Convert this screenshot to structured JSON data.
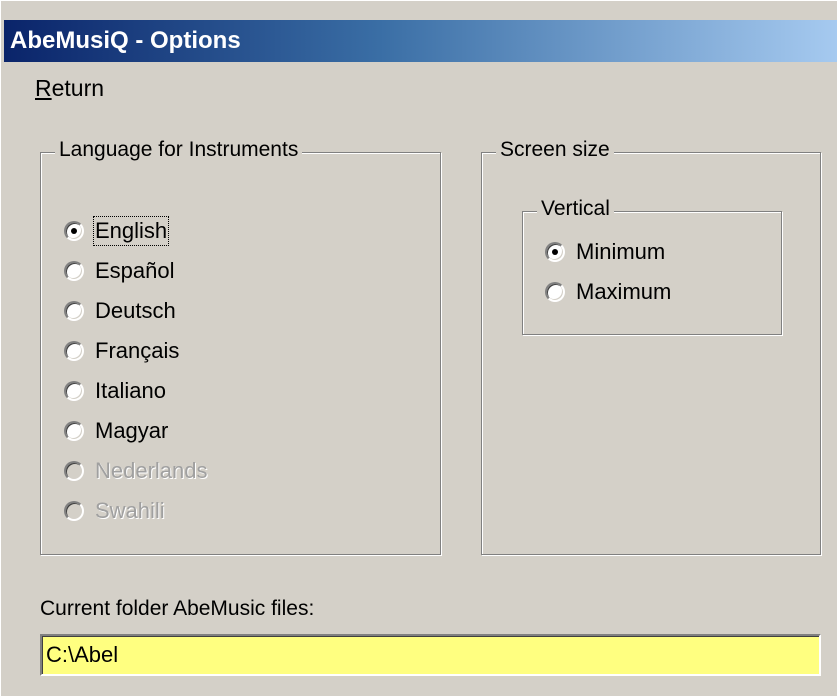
{
  "window": {
    "title": "AbeMusiQ - Options"
  },
  "menu": {
    "return_accel": "R",
    "return_rest": "eturn"
  },
  "language_group": {
    "label": "Language for Instruments",
    "options": [
      {
        "label": "English",
        "checked": true,
        "enabled": true
      },
      {
        "label": "Español",
        "checked": false,
        "enabled": true
      },
      {
        "label": "Deutsch",
        "checked": false,
        "enabled": true
      },
      {
        "label": "Français",
        "checked": false,
        "enabled": true
      },
      {
        "label": "Italiano",
        "checked": false,
        "enabled": true
      },
      {
        "label": "Magyar",
        "checked": false,
        "enabled": true
      },
      {
        "label": "Nederlands",
        "checked": false,
        "enabled": false
      },
      {
        "label": "Swahili",
        "checked": false,
        "enabled": false
      }
    ]
  },
  "screen_group": {
    "label": "Screen size",
    "vertical": {
      "label": "Vertical",
      "options": [
        {
          "label": "Minimum",
          "checked": true
        },
        {
          "label": "Maximum",
          "checked": false
        }
      ]
    }
  },
  "folder": {
    "caption": "Current folder AbeMusic files:",
    "value": "C:\\Abel"
  },
  "colors": {
    "title_start": "#0a246a",
    "title_end": "#a6caf0",
    "input_bg": "#ffff80",
    "face": "#d4d0c8"
  }
}
